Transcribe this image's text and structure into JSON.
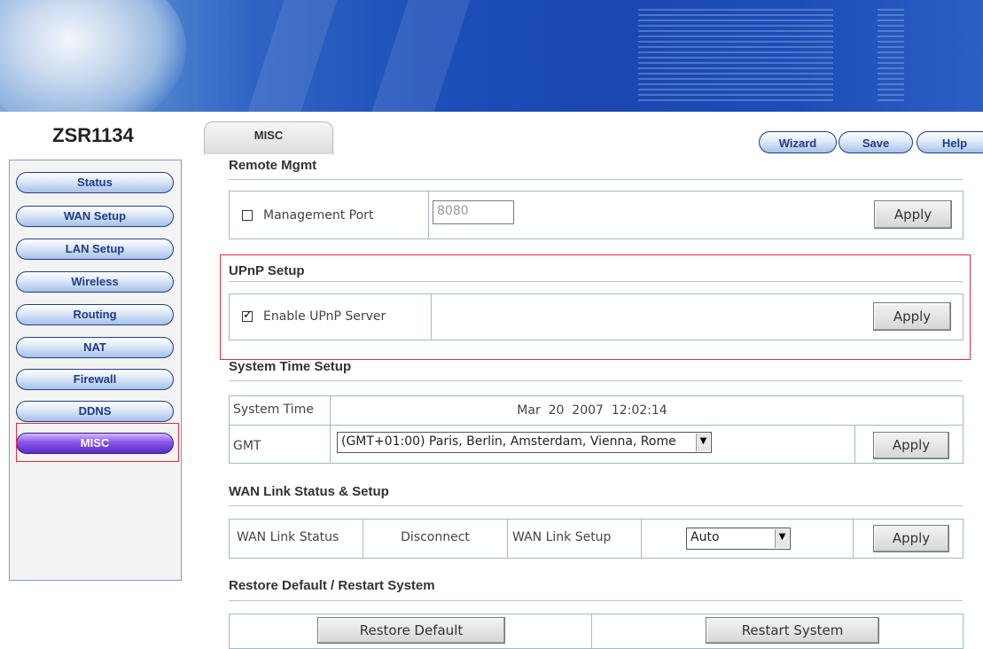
{
  "device": {
    "name": "ZSR1134"
  },
  "tab": {
    "label": "MISC"
  },
  "top_buttons": {
    "wizard": "Wizard",
    "save": "Save",
    "help": "Help"
  },
  "sidebar": {
    "items": [
      {
        "label": "Status"
      },
      {
        "label": "WAN Setup"
      },
      {
        "label": "LAN Setup"
      },
      {
        "label": "Wireless"
      },
      {
        "label": "Routing"
      },
      {
        "label": "NAT"
      },
      {
        "label": "Firewall"
      },
      {
        "label": "DDNS"
      },
      {
        "label": "MISC",
        "active": true
      }
    ]
  },
  "remote_mgmt": {
    "title": "Remote Mgmt",
    "checkbox_label": "Management Port",
    "checked": false,
    "port_value": "8080",
    "apply": "Apply"
  },
  "upnp": {
    "title": "UPnP Setup",
    "checkbox_label": "Enable UPnP Server",
    "checked": true,
    "apply": "Apply"
  },
  "system_time": {
    "title": "System Time Setup",
    "time_label": "System Time",
    "time_value": "Mar  20  2007  12:02:14",
    "gmt_label": "GMT",
    "gmt_value": "(GMT+01:00) Paris, Berlin, Amsterdam, Vienna, Rome",
    "apply": "Apply"
  },
  "wan_link": {
    "title": "WAN Link Status & Setup",
    "status_label": "WAN Link Status",
    "status_value": "Disconnect",
    "setup_label": "WAN Link Setup",
    "setup_value": "Auto",
    "apply": "Apply"
  },
  "restore": {
    "title": "Restore Default / Restart System",
    "restore_button": "Restore Default",
    "restart_button": "Restart System"
  },
  "colors": {
    "accent": "#1e3b8a",
    "highlight": "#e0303a",
    "active_nav": "#6a3bd8"
  },
  "icons": {
    "checkbox_tick": "check-icon",
    "dropdown": "chevron-down-icon"
  }
}
